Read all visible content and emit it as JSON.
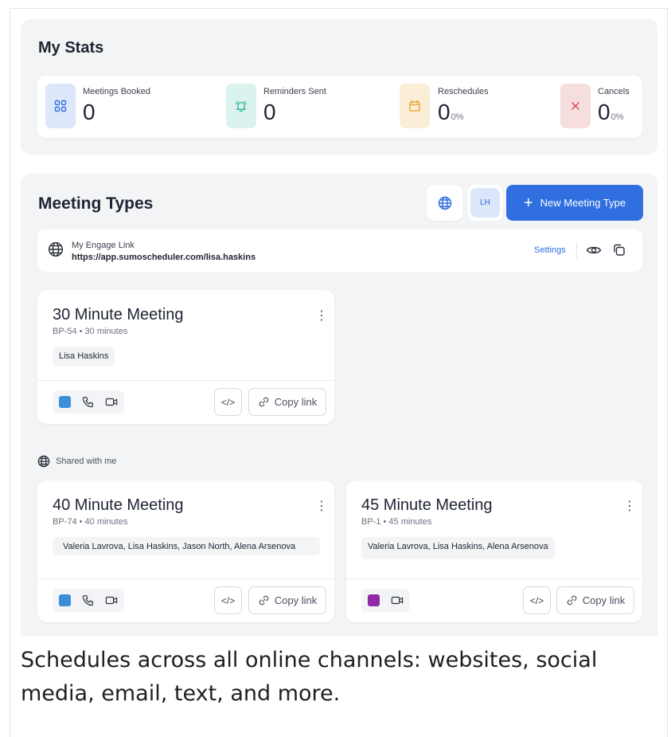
{
  "stats": {
    "title": "My Stats",
    "items": [
      {
        "label": "Meetings Booked",
        "value": "0",
        "pct": "",
        "icon": "grid-icon"
      },
      {
        "label": "Reminders Sent",
        "value": "0",
        "pct": "",
        "icon": "bell-icon"
      },
      {
        "label": "Reschedules",
        "value": "0",
        "pct": "0%",
        "icon": "calendar-icon"
      },
      {
        "label": "Cancels",
        "value": "0",
        "pct": "0%",
        "icon": "close-icon"
      }
    ]
  },
  "meeting_types": {
    "title": "Meeting Types",
    "avatar_initials": "LH",
    "new_button_label": "New Meeting Type",
    "engage": {
      "label": "My Engage Link",
      "url": "https://app.sumoscheduler.com/lisa.haskins",
      "settings_label": "Settings"
    },
    "own": [
      {
        "title": "30 Minute Meeting",
        "subtitle": "BP-54 • 30 minutes",
        "people": "Lisa Haskins",
        "color": "#3b8fd9",
        "tools": [
          "color-swatch",
          "phone-icon",
          "video-icon"
        ]
      }
    ],
    "shared_label": "Shared with me",
    "shared": [
      {
        "title": "40 Minute Meeting",
        "subtitle": "BP-74 • 40 minutes",
        "people": "Valeria Lavrova, Lisa Haskins, Jason North, Alena Arsenova",
        "color": "#3b8fd9",
        "tools": [
          "color-swatch",
          "phone-icon",
          "video-icon"
        ]
      },
      {
        "title": "45 Minute Meeting",
        "subtitle": "BP-1 • 45 minutes",
        "people": "Valeria Lavrova, Lisa Haskins, Alena Arsenova",
        "color": "#8e2aa8",
        "tools": [
          "color-swatch",
          "video-icon"
        ]
      }
    ],
    "copy_link_label": "Copy link",
    "embed_label": "</>"
  },
  "footer": {
    "text": "Schedules across all online channels: websites, social media, email, text, and more."
  },
  "colors": {
    "primary": "#2f6fe0",
    "meetings_icon_bg": "#dde7fa",
    "reminders_icon_bg": "#dbf3ef",
    "reschedules_icon_bg": "#fbeed6",
    "cancels_icon_bg": "#f6dede"
  }
}
